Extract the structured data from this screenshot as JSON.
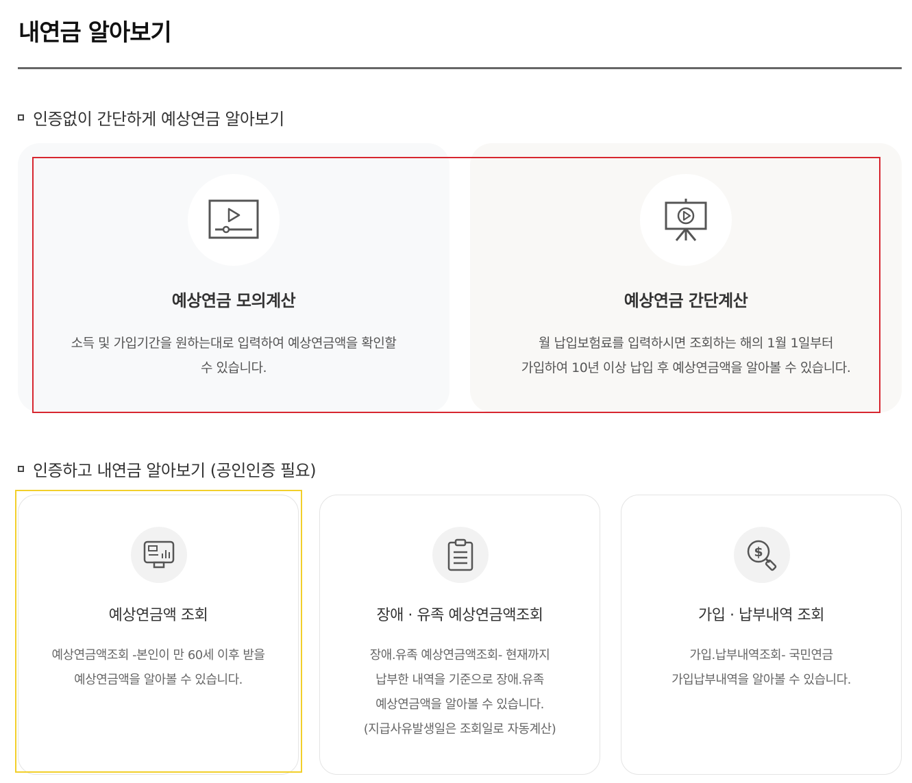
{
  "page": {
    "title": "내연금 알아보기"
  },
  "section_no_auth": {
    "heading": "인증없이 간단하게 예상연금 알아보기",
    "cards": [
      {
        "title": "예상연금 모의계산",
        "icon": "video-player-icon",
        "desc_line1": "소득 및 가입기간을 원하는대로 입력하여 예상연금액을 확인할",
        "desc_line2": "수 있습니다."
      },
      {
        "title": "예상연금 간단계산",
        "icon": "presentation-easel-icon",
        "desc_line1": "월 납입보험료를 입력하시면 조회하는 해의 1월 1일부터",
        "desc_line2": "가입하여 10년 이상 납입 후 예상연금액을 알아볼 수 있습니다."
      }
    ]
  },
  "section_auth": {
    "heading": "인증하고 내연금 알아보기 (공인인증 필요)",
    "cards": [
      {
        "title": "예상연금액 조회",
        "icon": "monitor-chart-icon",
        "desc_line1": "예상연금액조회 -본인이 만 60세 이후 받을",
        "desc_line2": "예상연금액을 알아볼 수 있습니다."
      },
      {
        "title": "장애 · 유족 예상연금액조회",
        "icon": "clipboard-icon",
        "desc_line1": "장애.유족 예상연금액조회- 현재까지",
        "desc_line2": "납부한 내역을 기준으로 장애.유족",
        "desc_line3": "예상연금액을 알아볼 수 있습니다.",
        "desc_line4": "(지급사유발생일은 조회일로 자동계산)"
      },
      {
        "title": "가입 · 납부내역 조회",
        "icon": "dollar-search-icon",
        "desc_line1": "가입.납부내역조회- 국민연금",
        "desc_line2": "가입납부내역을 알아볼 수 있습니다."
      }
    ]
  },
  "colors": {
    "highlight_red": "#d7262f",
    "highlight_yellow": "#f2cf2a",
    "icon_stroke": "#555555"
  }
}
